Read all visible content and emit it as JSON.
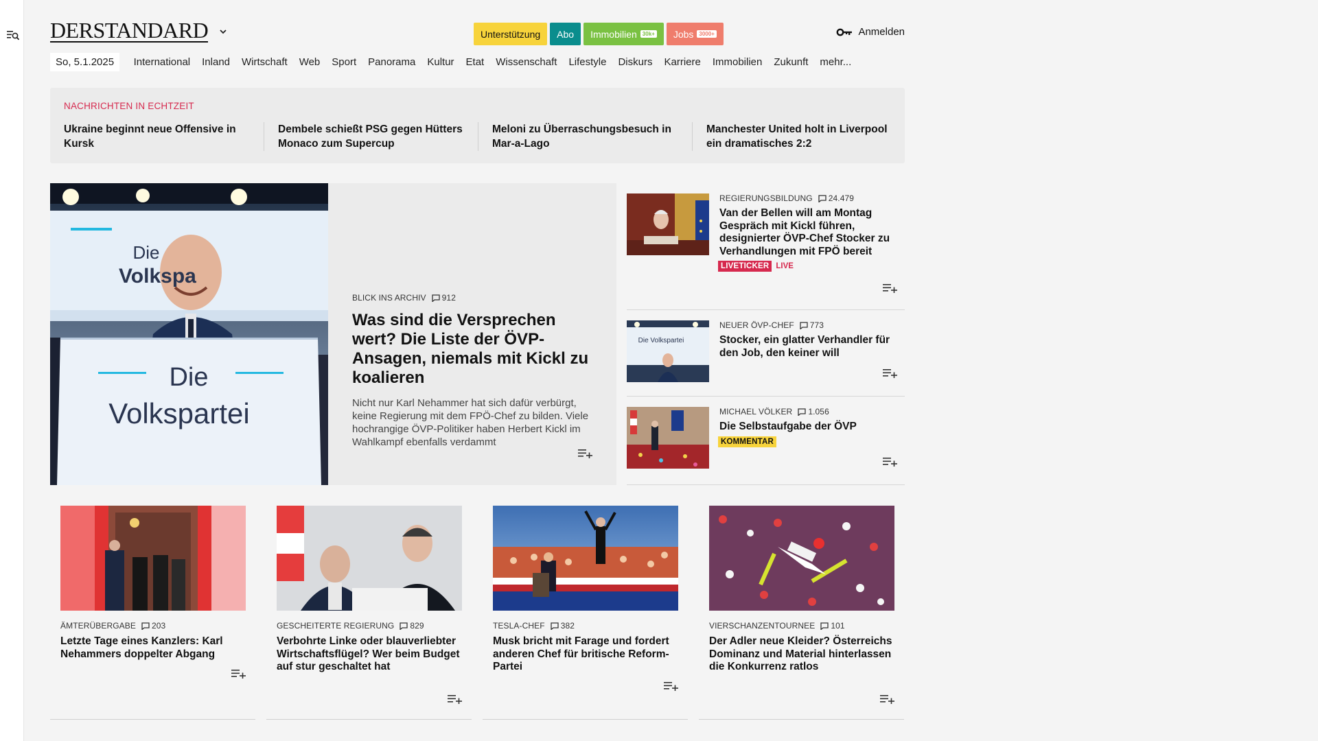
{
  "header": {
    "logo_text": "DERSTANDARD",
    "pills": [
      {
        "label": "Unterstützung",
        "color": "#f7d33b",
        "text_color": "#111111",
        "count": ""
      },
      {
        "label": "Abo",
        "color": "#0a8d8d",
        "text_color": "#ffffff",
        "count": ""
      },
      {
        "label": "Immobilien",
        "color": "#7ac142",
        "text_color": "#ffffff",
        "count": "30k+"
      },
      {
        "label": "Jobs",
        "color": "#ef7d6c",
        "text_color": "#ffffff",
        "count": "3000+"
      }
    ],
    "login_label": "Anmelden"
  },
  "nav": {
    "date": "So, 5.1.2025",
    "items": [
      "International",
      "Inland",
      "Wirtschaft",
      "Web",
      "Sport",
      "Panorama",
      "Kultur",
      "Etat",
      "Wissenschaft",
      "Lifestyle",
      "Diskurs",
      "Karriere",
      "Immobilien",
      "Zukunft",
      "mehr..."
    ]
  },
  "ticker": {
    "label": "NACHRICHTEN IN ECHTZEIT",
    "items": [
      "Ukraine beginnt neue Offensive in Kursk",
      "Dembele schießt PSG gegen Hütters Monaco zum Supercup",
      "Meloni zu Überraschungsbesuch in Mar-a-Lago",
      "Manchester United holt in Liverpool ein dramatisches 2:2"
    ]
  },
  "lead": {
    "image_alt": "Die Volkspartei",
    "kicker": "BLICK INS ARCHIV",
    "comments": "912",
    "title": "Was sind die Versprechen wert? Die Liste der ÖVP-Ansagen, niemals mit Kickl zu koalieren",
    "teaser": "Nicht nur Karl Nehammer hat sich dafür verbürgt, keine Regierung mit dem FPÖ-Chef zu bilden. Viele hochrangige ÖVP-Politiker haben Herbert Kickl im Wahlkampf ebenfalls verdammt"
  },
  "side": [
    {
      "kicker": "REGIERUNGSBILDUNG",
      "comments": "24.479",
      "title": "Van der Bellen will am Montag Gespräch mit Kickl führen, designierter ÖVP-Chef Stocker zu Verhandlungen mit FPÖ bereit",
      "badge": "LIVETICKER",
      "badge_extra": "LIVE"
    },
    {
      "kicker": "NEUER ÖVP-CHEF",
      "comments": "773",
      "title": "Stocker, ein glatter Verhandler für den Job, den keiner will",
      "thumb_text": "Die Volkspartei"
    },
    {
      "kicker": "MICHAEL VÖLKER",
      "comments": "1.056",
      "title": "Die Selbstaufgabe der ÖVP",
      "badge": "KOMMENTAR"
    }
  ],
  "cards": [
    {
      "kicker": "ÄMTERÜBERGABE",
      "comments": "203",
      "title": "Letzte Tage eines Kanzlers: Karl Nehammers doppelter Abgang"
    },
    {
      "kicker": "GESCHEITERTE REGIERUNG",
      "comments": "829",
      "title": "Verbohrte Linke oder blauverliebter Wirtschaftsflügel? Wer beim Budget auf stur geschaltet hat"
    },
    {
      "kicker": "TESLA-CHEF",
      "comments": "382",
      "title": "Musk bricht mit Farage und fordert anderen Chef für britische Reform-Partei"
    },
    {
      "kicker": "VIERSCHANZENTOURNEE",
      "comments": "101",
      "title": "Der Adler neue Kleider? Österreichs Dominanz und Material hinterlassen die Konkurrenz ratlos"
    }
  ],
  "icons": {
    "menu": "menu-search-icon",
    "logo_dropdown": "chevron-down-icon",
    "login": "key-icon",
    "comments": "comment-icon",
    "add": "playlist-add-icon"
  }
}
